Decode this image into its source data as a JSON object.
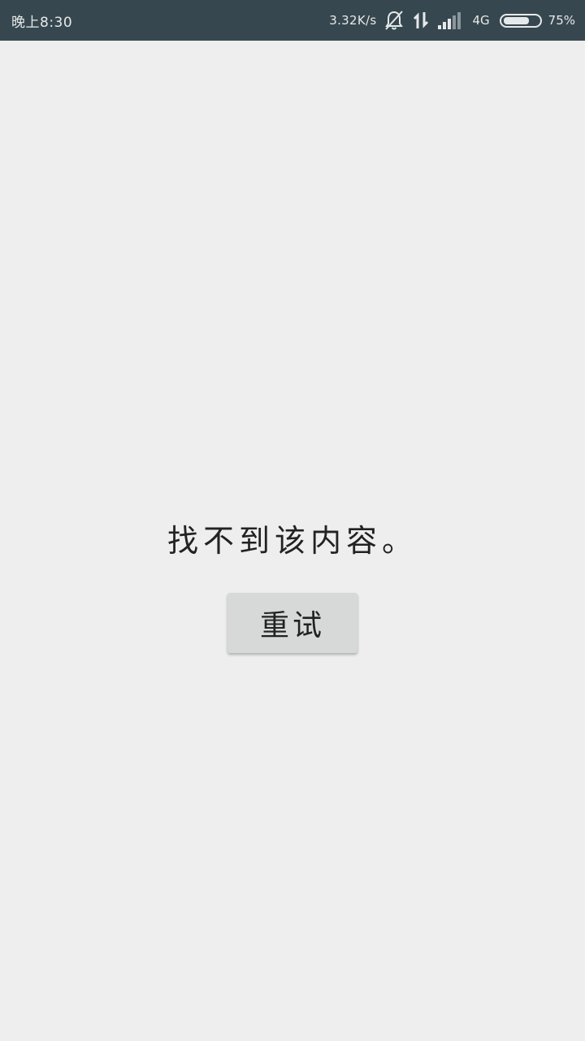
{
  "status_bar": {
    "time": "晚上8:30",
    "net_speed": "3.32K/s",
    "network_type": "4G",
    "battery_percent": "75%",
    "battery_level": 0.75,
    "icons": [
      "notifications-off-icon",
      "data-transfer-icon",
      "signal-icon",
      "battery-icon"
    ]
  },
  "main": {
    "message": "找不到该内容。",
    "retry_label": "重试"
  },
  "colors": {
    "status_bar_bg": "#37474f",
    "page_bg": "#eeeeee",
    "button_bg": "#d7d8d8",
    "text": "#222222"
  }
}
